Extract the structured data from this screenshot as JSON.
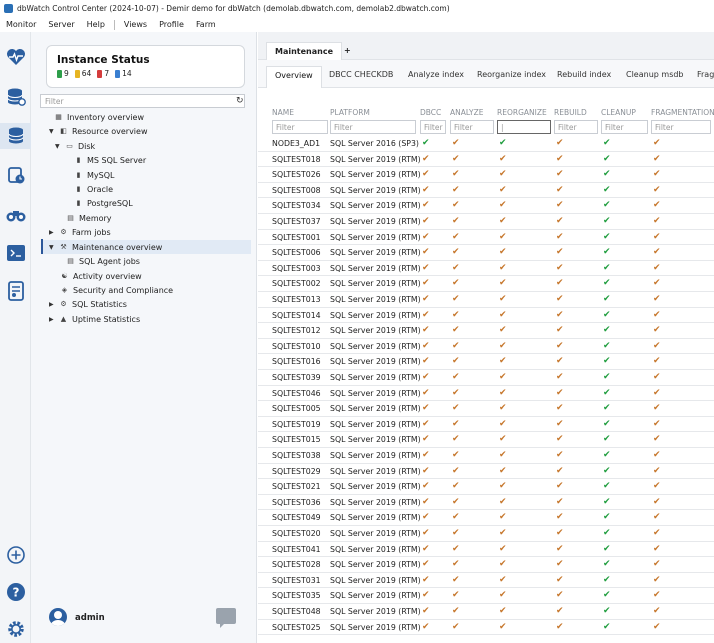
{
  "titlebar": {
    "text": "dbWatch Control Center  (2024-10-07) - Demir demo for dbWatch (demolab.dbwatch.com, demolab2.dbwatch.com)"
  },
  "menu": [
    "Monitor",
    "Server",
    "Help",
    "Views",
    "Profile",
    "Farm"
  ],
  "rail_icons": [
    "heartbeat-icon",
    "database-stack-icon",
    "database-active-icon",
    "database-clock-icon",
    "binoculars-icon",
    "terminal-icon",
    "report-icon",
    "add-icon",
    "help-icon",
    "settings-icon"
  ],
  "status": {
    "title": "Instance Status",
    "counts": [
      {
        "value": "9",
        "color": "#2e9e4a"
      },
      {
        "value": "64",
        "color": "#e6b422"
      },
      {
        "value": "7",
        "color": "#d43c3c"
      },
      {
        "value": "14",
        "color": "#3a7fd0"
      }
    ]
  },
  "sidebar": {
    "filter_placeholder": "Filter",
    "tree": {
      "inventory": "Inventory overview",
      "resource": "Resource overview",
      "disk": "Disk",
      "mssql": "MS SQL Server",
      "mysql": "MySQL",
      "oracle": "Oracle",
      "postgres": "PostgreSQL",
      "memory": "Memory",
      "farm_jobs": "Farm jobs",
      "maintenance": "Maintenance overview",
      "sql_agent": "SQL Agent jobs",
      "activity": "Activity overview",
      "security": "Security and Compliance",
      "sql_stats": "SQL Statistics",
      "uptime": "Uptime Statistics"
    }
  },
  "user": {
    "name": "admin"
  },
  "tabs": {
    "main": "Maintenance",
    "add": "+"
  },
  "subtabs": [
    "Overview",
    "DBCC CHECKDB",
    "Analyze index",
    "Reorganize index",
    "Rebuild index",
    "Cleanup msdb",
    "Fragmentation"
  ],
  "columns": [
    "NAME",
    "PLATFORM",
    "DBCC",
    "ANALYZE",
    "REORGANIZE",
    "REBUILD",
    "CLEANUP",
    "FRAGMENTATION"
  ],
  "filter_placeholder": "Filter",
  "status_colors": {
    "g": "#1f9d3e",
    "o": "#c6762b"
  },
  "rows": [
    {
      "name": "NODE3_AD1",
      "platform": "SQL Server 2016 (SP3)",
      "st": [
        "g",
        "o",
        "g",
        "o",
        "g",
        "o"
      ]
    },
    {
      "name": "SQLTEST018",
      "platform": "SQL Server 2019 (RTM)",
      "st": [
        "o",
        "o",
        "o",
        "o",
        "g",
        "o"
      ]
    },
    {
      "name": "SQLTEST026",
      "platform": "SQL Server 2019 (RTM)",
      "st": [
        "o",
        "o",
        "o",
        "o",
        "g",
        "o"
      ]
    },
    {
      "name": "SQLTEST008",
      "platform": "SQL Server 2019 (RTM)",
      "st": [
        "o",
        "o",
        "o",
        "o",
        "g",
        "o"
      ]
    },
    {
      "name": "SQLTEST034",
      "platform": "SQL Server 2019 (RTM)",
      "st": [
        "o",
        "o",
        "o",
        "o",
        "g",
        "o"
      ]
    },
    {
      "name": "SQLTEST037",
      "platform": "SQL Server 2019 (RTM)",
      "st": [
        "o",
        "o",
        "o",
        "o",
        "g",
        "o"
      ]
    },
    {
      "name": "SQLTEST001",
      "platform": "SQL Server 2019 (RTM)",
      "st": [
        "o",
        "o",
        "o",
        "o",
        "g",
        "o"
      ]
    },
    {
      "name": "SQLTEST006",
      "platform": "SQL Server 2019 (RTM)",
      "st": [
        "o",
        "o",
        "o",
        "o",
        "g",
        "o"
      ]
    },
    {
      "name": "SQLTEST003",
      "platform": "SQL Server 2019 (RTM)",
      "st": [
        "o",
        "o",
        "o",
        "o",
        "g",
        "o"
      ]
    },
    {
      "name": "SQLTEST002",
      "platform": "SQL Server 2019 (RTM)",
      "st": [
        "o",
        "o",
        "o",
        "o",
        "g",
        "o"
      ]
    },
    {
      "name": "SQLTEST013",
      "platform": "SQL Server 2019 (RTM)",
      "st": [
        "o",
        "o",
        "o",
        "o",
        "g",
        "o"
      ]
    },
    {
      "name": "SQLTEST014",
      "platform": "SQL Server 2019 (RTM)",
      "st": [
        "o",
        "o",
        "o",
        "o",
        "g",
        "o"
      ]
    },
    {
      "name": "SQLTEST012",
      "platform": "SQL Server 2019 (RTM)",
      "st": [
        "o",
        "o",
        "o",
        "o",
        "g",
        "o"
      ]
    },
    {
      "name": "SQLTEST010",
      "platform": "SQL Server 2019 (RTM)",
      "st": [
        "o",
        "o",
        "o",
        "o",
        "g",
        "o"
      ]
    },
    {
      "name": "SQLTEST016",
      "platform": "SQL Server 2019 (RTM)",
      "st": [
        "o",
        "o",
        "o",
        "o",
        "g",
        "o"
      ]
    },
    {
      "name": "SQLTEST039",
      "platform": "SQL Server 2019 (RTM)",
      "st": [
        "o",
        "o",
        "o",
        "o",
        "g",
        "o"
      ]
    },
    {
      "name": "SQLTEST046",
      "platform": "SQL Server 2019 (RTM)",
      "st": [
        "o",
        "o",
        "o",
        "o",
        "g",
        "o"
      ]
    },
    {
      "name": "SQLTEST005",
      "platform": "SQL Server 2019 (RTM)",
      "st": [
        "o",
        "o",
        "o",
        "o",
        "g",
        "o"
      ]
    },
    {
      "name": "SQLTEST019",
      "platform": "SQL Server 2019 (RTM)",
      "st": [
        "o",
        "o",
        "o",
        "o",
        "g",
        "o"
      ]
    },
    {
      "name": "SQLTEST015",
      "platform": "SQL Server 2019 (RTM)",
      "st": [
        "o",
        "o",
        "o",
        "o",
        "g",
        "o"
      ]
    },
    {
      "name": "SQLTEST038",
      "platform": "SQL Server 2019 (RTM)",
      "st": [
        "o",
        "o",
        "o",
        "o",
        "g",
        "o"
      ]
    },
    {
      "name": "SQLTEST029",
      "platform": "SQL Server 2019 (RTM)",
      "st": [
        "o",
        "o",
        "o",
        "o",
        "g",
        "o"
      ]
    },
    {
      "name": "SQLTEST021",
      "platform": "SQL Server 2019 (RTM)",
      "st": [
        "o",
        "o",
        "o",
        "o",
        "g",
        "o"
      ]
    },
    {
      "name": "SQLTEST036",
      "platform": "SQL Server 2019 (RTM)",
      "st": [
        "o",
        "o",
        "o",
        "o",
        "g",
        "o"
      ]
    },
    {
      "name": "SQLTEST049",
      "platform": "SQL Server 2019 (RTM)",
      "st": [
        "o",
        "o",
        "o",
        "o",
        "g",
        "o"
      ]
    },
    {
      "name": "SQLTEST020",
      "platform": "SQL Server 2019 (RTM)",
      "st": [
        "o",
        "o",
        "o",
        "o",
        "g",
        "o"
      ]
    },
    {
      "name": "SQLTEST041",
      "platform": "SQL Server 2019 (RTM)",
      "st": [
        "o",
        "o",
        "o",
        "o",
        "g",
        "o"
      ]
    },
    {
      "name": "SQLTEST028",
      "platform": "SQL Server 2019 (RTM)",
      "st": [
        "o",
        "o",
        "o",
        "o",
        "g",
        "o"
      ]
    },
    {
      "name": "SQLTEST031",
      "platform": "SQL Server 2019 (RTM)",
      "st": [
        "o",
        "o",
        "o",
        "o",
        "g",
        "o"
      ]
    },
    {
      "name": "SQLTEST035",
      "platform": "SQL Server 2019 (RTM)",
      "st": [
        "o",
        "o",
        "o",
        "o",
        "g",
        "o"
      ]
    },
    {
      "name": "SQLTEST048",
      "platform": "SQL Server 2019 (RTM)",
      "st": [
        "o",
        "o",
        "o",
        "o",
        "g",
        "o"
      ]
    },
    {
      "name": "SQLTEST025",
      "platform": "SQL Server 2019 (RTM)",
      "st": [
        "o",
        "o",
        "o",
        "o",
        "g",
        "o"
      ]
    }
  ]
}
